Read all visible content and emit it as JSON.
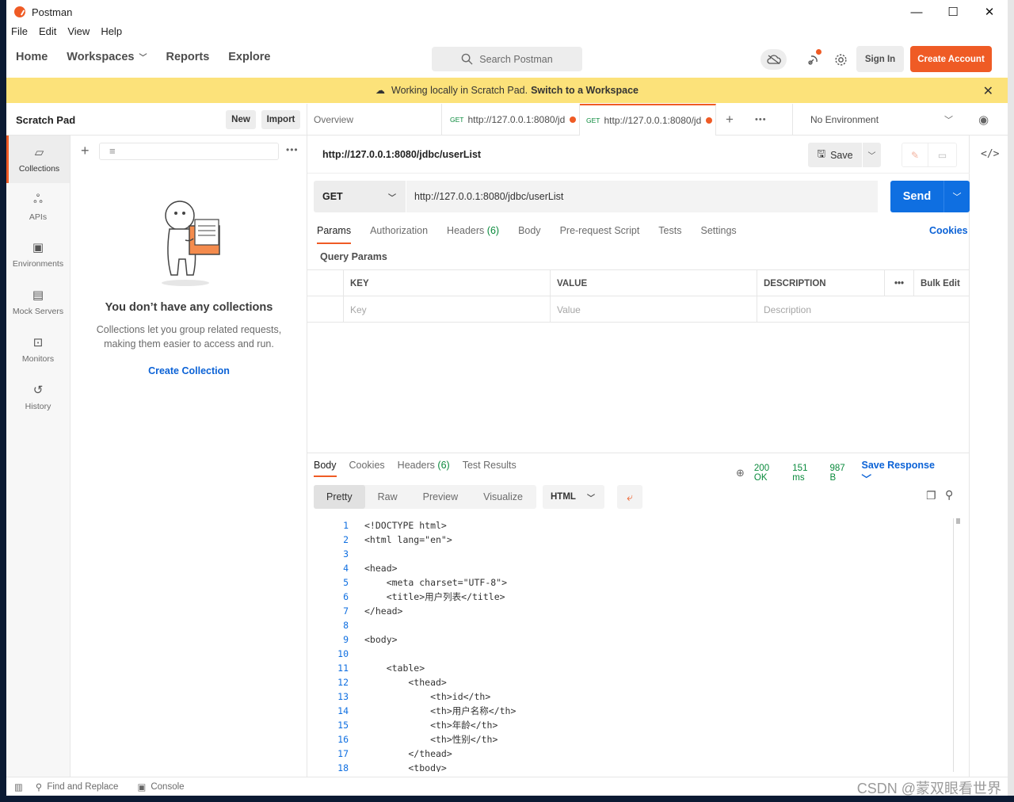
{
  "app": {
    "title": "Postman",
    "menu": [
      "File",
      "Edit",
      "View",
      "Help"
    ]
  },
  "window_controls": {
    "minimize": "—",
    "maximize": "☐",
    "close": "✕"
  },
  "header": {
    "nav": [
      "Home",
      "Workspaces",
      "Reports",
      "Explore"
    ],
    "search_placeholder": "Search Postman",
    "sign_in": "Sign In",
    "create_account": "Create Account"
  },
  "banner": {
    "text": "Working locally in Scratch Pad.",
    "link": "Switch to a Workspace"
  },
  "sidebar": {
    "title": "Scratch Pad",
    "new_label": "New",
    "import_label": "Import",
    "rail": [
      {
        "label": "Collections",
        "icon": "collections-icon"
      },
      {
        "label": "APIs",
        "icon": "apis-icon"
      },
      {
        "label": "Environments",
        "icon": "environments-icon"
      },
      {
        "label": "Mock Servers",
        "icon": "mock-servers-icon"
      },
      {
        "label": "Monitors",
        "icon": "monitors-icon"
      },
      {
        "label": "History",
        "icon": "history-icon"
      }
    ],
    "empty_title": "You don’t have any collections",
    "empty_desc_1": "Collections let you group related requests,",
    "empty_desc_2": "making them easier to access and run.",
    "create_collection": "Create Collection"
  },
  "tabs": {
    "overview": "Overview",
    "items": [
      {
        "method": "GET",
        "label": "http://127.0.0.1:8080/jd"
      },
      {
        "method": "GET",
        "label": "http://127.0.0.1:8080/jd"
      }
    ],
    "environment": "No Environment"
  },
  "request": {
    "title": "http://127.0.0.1:8080/jdbc/userList",
    "save_label": "Save",
    "method": "GET",
    "url": "http://127.0.0.1:8080/jdbc/userList",
    "send_label": "Send",
    "tabs": [
      {
        "label": "Params",
        "count": ""
      },
      {
        "label": "Authorization",
        "count": ""
      },
      {
        "label": "Headers",
        "count": "(6)"
      },
      {
        "label": "Body",
        "count": ""
      },
      {
        "label": "Pre-request Script",
        "count": ""
      },
      {
        "label": "Tests",
        "count": ""
      },
      {
        "label": "Settings",
        "count": ""
      }
    ],
    "cookies_label": "Cookies",
    "query_params_title": "Query Params",
    "table_headers": {
      "key": "KEY",
      "value": "VALUE",
      "description": "DESCRIPTION",
      "bulk_edit": "Bulk Edit"
    },
    "placeholders": {
      "key": "Key",
      "value": "Value",
      "description": "Description"
    }
  },
  "response": {
    "tabs": [
      {
        "label": "Body",
        "count": ""
      },
      {
        "label": "Cookies",
        "count": ""
      },
      {
        "label": "Headers",
        "count": "(6)"
      },
      {
        "label": "Test Results",
        "count": ""
      }
    ],
    "status": "200 OK",
    "time": "151 ms",
    "size": "987 B",
    "save_response": "Save Response",
    "formats": [
      "Pretty",
      "Raw",
      "Preview",
      "Visualize"
    ],
    "language": "HTML",
    "code_lines": [
      "<!DOCTYPE html>",
      "<html lang=\"en\">",
      "",
      "<head>",
      "    <meta charset=\"UTF-8\">",
      "    <title>用户列表</title>",
      "</head>",
      "",
      "<body>",
      "",
      "    <table>",
      "        <thead>",
      "            <th>id</th>",
      "            <th>用户名称</th>",
      "            <th>年龄</th>",
      "            <th>性别</th>",
      "        </thead>",
      "        <tbody>"
    ]
  },
  "statusbar": {
    "find_replace": "Find and Replace",
    "console": "Console",
    "watermark": "CSDN @蒙双眼看世界"
  }
}
